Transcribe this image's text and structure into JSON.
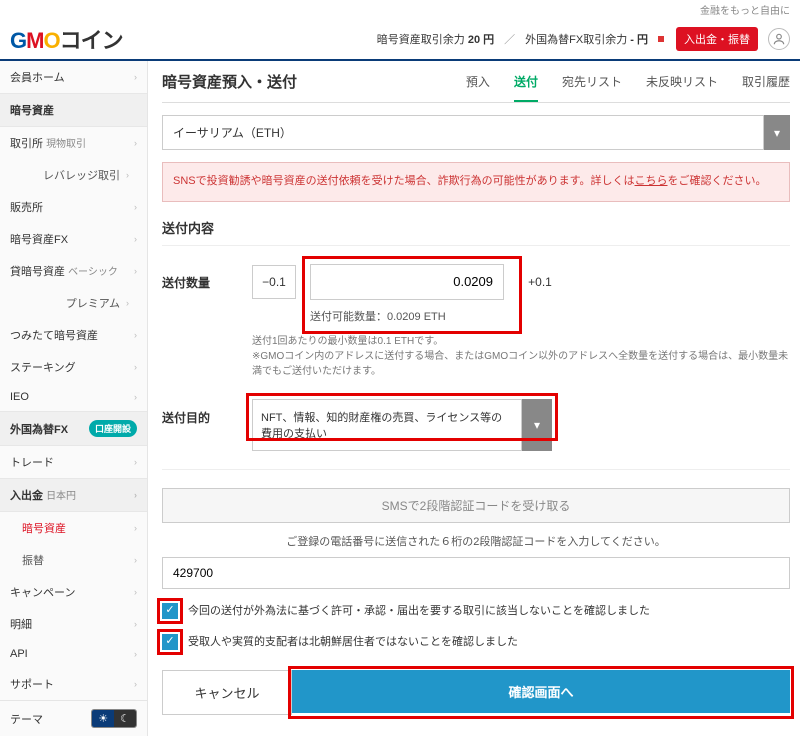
{
  "tagline": "金融をもっと自由に",
  "logo_text": "GMOコイン",
  "header": {
    "crypto_balance_label": "暗号資産取引余力",
    "crypto_balance_value": "20 円",
    "fx_balance_label": "外国為替FX取引余力",
    "fx_balance_value": "- 円",
    "deposit_btn": "入出金・振替"
  },
  "sidebar": {
    "home": "会員ホーム",
    "crypto_head": "暗号資産",
    "exchange": "取引所",
    "spot": "現物取引",
    "leverage": "レバレッジ取引",
    "sales": "販売所",
    "crypto_fx": "暗号資産FX",
    "lending": "貸暗号資産",
    "basic": "ベーシック",
    "premium": "プレミアム",
    "tsumitate": "つみたて暗号資産",
    "staking": "ステーキング",
    "ieo": "IEO",
    "forex_head": "外国為替FX",
    "forex_badge": "口座開設",
    "trade": "トレード",
    "io_head": "入出金",
    "io_jpy": "日本円",
    "io_crypto": "暗号資産",
    "io_transfer": "振替",
    "campaign": "キャンペーン",
    "detail": "明細",
    "api": "API",
    "support": "サポート",
    "theme": "テーマ"
  },
  "page": {
    "title": "暗号資産預入・送付",
    "tabs": {
      "deposit": "預入",
      "send": "送付",
      "addr_list": "宛先リスト",
      "pending": "未反映リスト",
      "history": "取引履歴"
    },
    "asset_selected": "イーサリアム（ETH）",
    "warn_text_a": "SNSで投資勧誘や暗号資産の送付依頼を受けた場合、詐欺行為の可能性があります。詳しくは",
    "warn_link": "こちら",
    "warn_text_b": "をご確認ください。",
    "section_title": "送付内容",
    "qty_label": "送付数量",
    "qty_minus": "−0.1",
    "qty_plus": "+0.1",
    "qty_value": "0.0209",
    "qty_avail": "送付可能数量：0.0209 ETH",
    "qty_note1": "送付1回あたりの最小数量は0.1 ETHです。",
    "qty_note2": "※GMOコイン内のアドレスに送付する場合、またはGMOコイン以外のアドレスへ全数量を送付する場合は、最小数量未満でもご送付いただけます。",
    "purpose_label": "送付目的",
    "purpose_value": "NFT、情報、知的財産権の売買、ライセンス等の費用の支払い",
    "sms_btn": "SMSで2段階認証コードを受け取る",
    "sms_note": "ご登録の電話番号に送信された６桁の2段階認証コードを入力してください。",
    "sms_code": "429700",
    "chk1": "今回の送付が外為法に基づく許可・承認・届出を要する取引に該当しないことを確認しました",
    "chk2": "受取人や実質的支配者は北朝鮮居住者ではないことを確認しました",
    "btn_cancel": "キャンセル",
    "btn_confirm": "確認画面へ"
  }
}
